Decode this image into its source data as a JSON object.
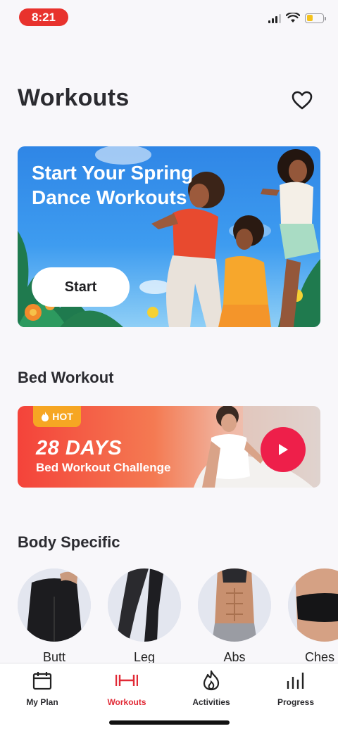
{
  "status_bar": {
    "time": "8:21",
    "battery_level": 0.4,
    "colors": {
      "time_pill": "#e8322d",
      "battery": "#f4c21c"
    }
  },
  "header": {
    "title": "Workouts",
    "favorite_icon": "heart-outline-icon"
  },
  "hero": {
    "title": "Start Your Spring Dance Workouts",
    "button_label": "Start"
  },
  "bed_workout": {
    "section_title": "Bed Workout",
    "badge": "HOT",
    "badge_icon": "flame-icon",
    "days": "28 DAYS",
    "subtitle": "Bed Workout Challenge",
    "play_icon": "play-icon"
  },
  "body_specific": {
    "section_title": "Body Specific",
    "items": [
      {
        "label": "Butt"
      },
      {
        "label": "Leg"
      },
      {
        "label": "Abs"
      },
      {
        "label": "Ches"
      }
    ]
  },
  "tab_bar": {
    "active": "Workouts",
    "accent_color": "#e12a36",
    "tabs": [
      {
        "label": "My Plan",
        "icon": "calendar-icon"
      },
      {
        "label": "Workouts",
        "icon": "dumbbell-icon"
      },
      {
        "label": "Activities",
        "icon": "flame-outline-icon"
      },
      {
        "label": "Progress",
        "icon": "bar-chart-icon"
      }
    ]
  }
}
